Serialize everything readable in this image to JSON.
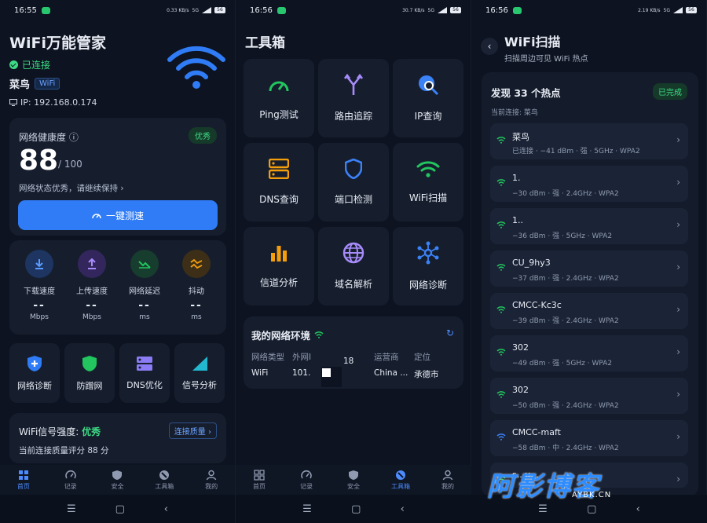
{
  "status": {
    "left": {
      "time": "16:55",
      "speed": "0.33 KB/s"
    },
    "mid": {
      "time": "16:56",
      "speed": "30.7 KB/s"
    },
    "right": {
      "time": "16:56",
      "speed": "2.19 KB/s"
    },
    "network": "5G",
    "battery": "56"
  },
  "home": {
    "app_title": "WiFi万能管家",
    "connected": "已连接",
    "ssid": "菜鸟",
    "ssid_chip": "WiFi",
    "ip": "IP: 192.168.0.174",
    "health_label": "网络健康度",
    "health_badge": "优秀",
    "health_score": "88",
    "health_max": "/ 100",
    "health_desc": "网络状态优秀，请继续保持 ›",
    "speedtest_button": "一键测速",
    "speed_items": [
      {
        "label": "下载速度",
        "value": "--",
        "unit": "Mbps",
        "icon": "download-icon",
        "color": "#2f7cf6"
      },
      {
        "label": "上传速度",
        "value": "--",
        "unit": "Mbps",
        "icon": "upload-icon",
        "color": "#8b5cf6"
      },
      {
        "label": "网络延迟",
        "value": "--",
        "unit": "ms",
        "icon": "latency-icon",
        "color": "#22c55e"
      },
      {
        "label": "抖动",
        "value": "--",
        "unit": "ms",
        "icon": "jitter-icon",
        "color": "#f59e0b"
      }
    ],
    "tools": [
      {
        "label": "网络诊断",
        "icon": "shield-plus-icon"
      },
      {
        "label": "防蹭网",
        "icon": "shield-icon"
      },
      {
        "label": "DNS优化",
        "icon": "server-icon"
      },
      {
        "label": "信号分析",
        "icon": "signal-icon"
      }
    ],
    "signal_label": "WiFi信号强度:",
    "signal_value": "优秀",
    "signal_link": "连接质量 ›",
    "quality_text": "当前连接质量评分 88 分"
  },
  "tools_page": {
    "title": "工具箱",
    "tiles": [
      {
        "label": "Ping测试",
        "icon": "gauge-icon",
        "color": "#22c55e"
      },
      {
        "label": "路由追踪",
        "icon": "route-icon",
        "color": "#a78bfa"
      },
      {
        "label": "IP查询",
        "icon": "ip-search-icon",
        "color": "#3b82f6"
      },
      {
        "label": "DNS查询",
        "icon": "dns-icon",
        "color": "#f59e0b"
      },
      {
        "label": "端口检测",
        "icon": "port-shield-icon",
        "color": "#3b82f6"
      },
      {
        "label": "WiFi扫描",
        "icon": "wifi-icon",
        "color": "#22c55e"
      },
      {
        "label": "信道分析",
        "icon": "bar-chart-icon",
        "color": "#f59e0b"
      },
      {
        "label": "域名解析",
        "icon": "globe-icon",
        "color": "#a78bfa"
      },
      {
        "label": "网络诊断",
        "icon": "network-icon",
        "color": "#3b82f6"
      }
    ],
    "env_title": "我的网络环境",
    "env_columns": [
      {
        "key": "网络类型",
        "value": "WiFi"
      },
      {
        "key": "外网I",
        "value": "101."
      },
      {
        "key": "",
        "value": "18"
      },
      {
        "key": "运营商",
        "value": "China ..."
      },
      {
        "key": "定位",
        "value": "承德市"
      }
    ]
  },
  "scan_page": {
    "title": "WiFi扫描",
    "subtitle": "扫描周边可见 WiFi 热点",
    "found": "发现 33 个热点",
    "done_badge": "已完成",
    "current": "当前连接: 菜鸟",
    "networks": [
      {
        "name": "菜鸟",
        "detail": "已连接 · −41 dBm · 强 · 5GHz · WPA2",
        "color": "#22c55e"
      },
      {
        "name": "1.",
        "detail": "−30 dBm · 强 · 2.4GHz · WPA2",
        "color": "#22c55e"
      },
      {
        "name": "1..",
        "detail": "−36 dBm · 强 · 5GHz · WPA2",
        "color": "#22c55e"
      },
      {
        "name": "CU_9hy3",
        "detail": "−37 dBm · 强 · 2.4GHz · WPA2",
        "color": "#22c55e"
      },
      {
        "name": "CMCC-Kc3c",
        "detail": "−39 dBm · 强 · 2.4GHz · WPA2",
        "color": "#22c55e"
      },
      {
        "name": "302",
        "detail": "−49 dBm · 强 · 5GHz · WPA2",
        "color": "#22c55e"
      },
      {
        "name": "302",
        "detail": "−50 dBm · 强 · 2.4GHz · WPA2",
        "color": "#22c55e"
      },
      {
        "name": "CMCC-maft",
        "detail": "−58 dBm · 中 · 2.4GHz · WPA2",
        "color": "#3b82f6"
      },
      {
        "name": "s...u...",
        "detail": "",
        "color": "#22c55e"
      }
    ]
  },
  "nav": [
    {
      "label": "首页",
      "icon": "home-grid-icon"
    },
    {
      "label": "记录",
      "icon": "history-icon"
    },
    {
      "label": "安全",
      "icon": "security-icon"
    },
    {
      "label": "工具箱",
      "icon": "toolbox-icon"
    },
    {
      "label": "我的",
      "icon": "profile-icon"
    }
  ],
  "watermark": {
    "big": "阿影博客",
    "small": "AYBK.CN"
  },
  "accent": "#2f7cf6"
}
